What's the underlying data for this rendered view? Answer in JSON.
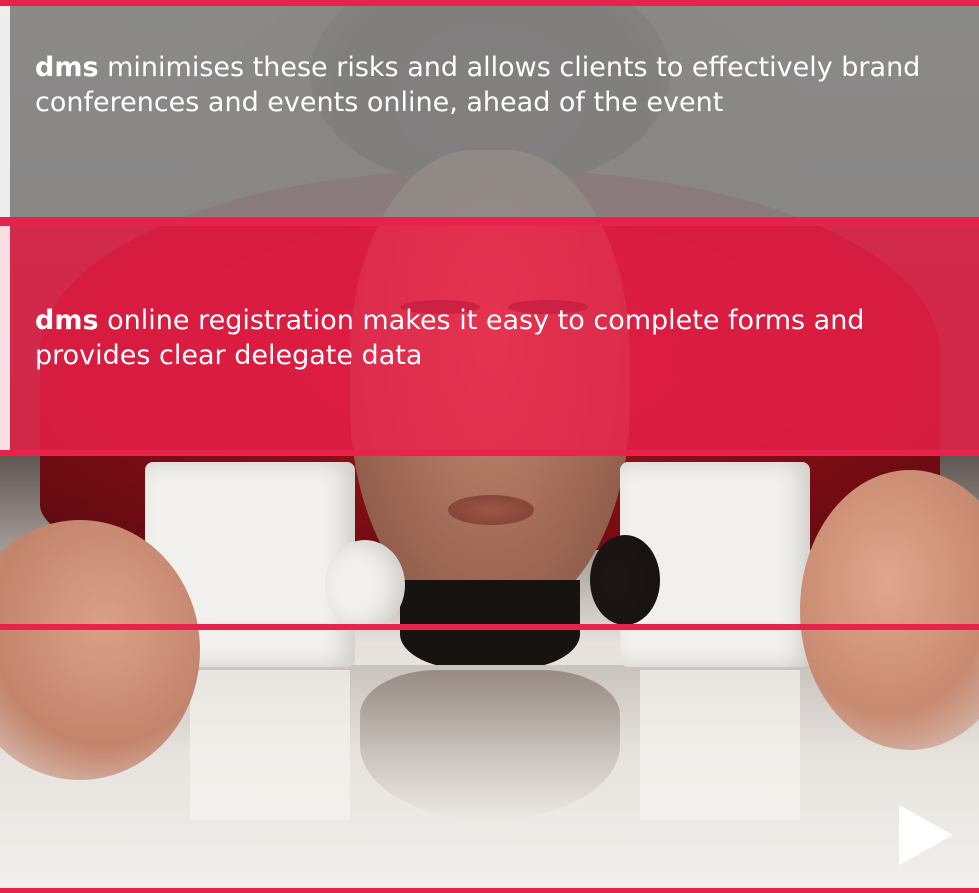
{
  "colors": {
    "accent": "#e8224a",
    "grey_band": "#8e8e8e",
    "pink_band": "#ec204b",
    "text": "#ffffff"
  },
  "panels": [
    {
      "brand": "dms",
      "text": " minimises these risks and allows clients to effectively brand conferences and events online, ahead of the event"
    },
    {
      "brand": "dms",
      "text": " online registration makes it easy to complete forms and provides clear delegate data"
    }
  ],
  "controls": {
    "next_icon": "play-triangle-icon"
  }
}
